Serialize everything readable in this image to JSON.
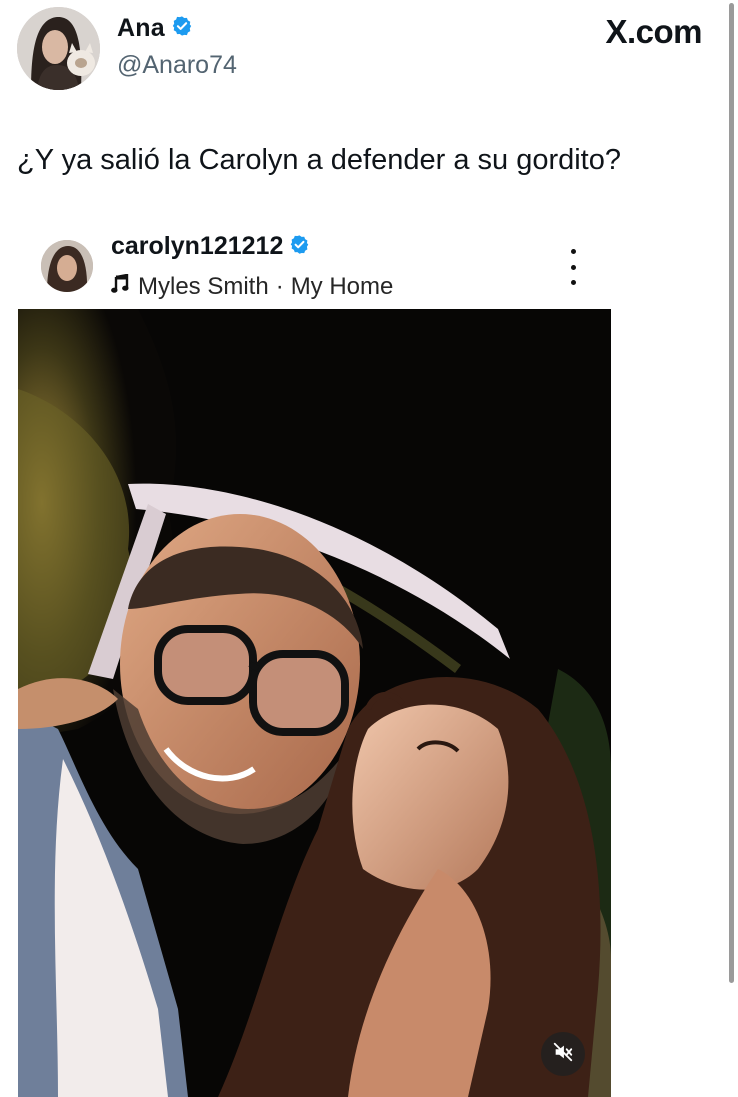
{
  "tweet": {
    "display_name": "Ana",
    "handle": "@Anaro74",
    "brand": "X.com",
    "text": "¿Y ya salió la Carolyn a defender a su gordito?"
  },
  "embedded_post": {
    "username": "carolyn121212",
    "music_artist": "Myles Smith",
    "music_separator": "·",
    "music_title": "My Home"
  },
  "icons": {
    "verified": "verified-badge-icon",
    "music": "music-note-icon",
    "more": "more-options-icon",
    "mute": "muted-speaker-icon"
  },
  "colors": {
    "verified_blue": "#1d9bf0",
    "text_primary": "#0f1419",
    "text_secondary": "#536471"
  }
}
